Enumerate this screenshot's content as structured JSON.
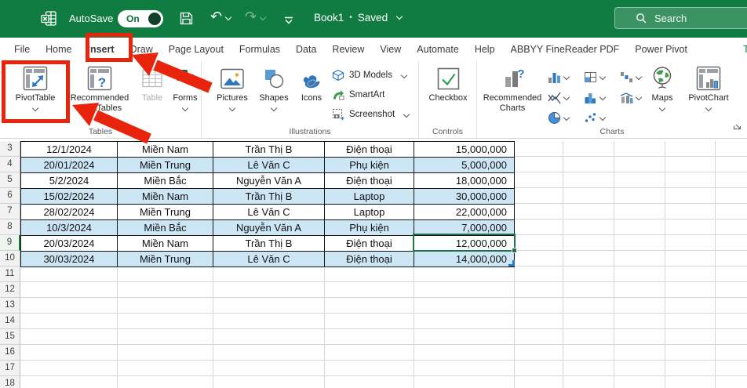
{
  "colors": {
    "excel_green": "#107C41",
    "annotation_red": "#E8240C",
    "band_blue": "#CDE6F5",
    "selection_green": "#1E7446",
    "ribbon_icon_blue": "#2E77C0"
  },
  "titlebar": {
    "autosave_label": "AutoSave",
    "autosave_state": "On",
    "doc_title": "Book1",
    "doc_separator": "•",
    "doc_status": "Saved",
    "search_placeholder": "Search"
  },
  "ribbon_tabs": [
    {
      "label": "File"
    },
    {
      "label": "Home"
    },
    {
      "label": "Insert",
      "active": true
    },
    {
      "label": "Draw"
    },
    {
      "label": "Page Layout"
    },
    {
      "label": "Formulas"
    },
    {
      "label": "Data"
    },
    {
      "label": "Review"
    },
    {
      "label": "View"
    },
    {
      "label": "Automate"
    },
    {
      "label": "Help"
    },
    {
      "label": "ABBYY FineReader PDF"
    },
    {
      "label": "Power Pivot"
    },
    {
      "label": "Tabl",
      "contextual": true
    }
  ],
  "ribbon": {
    "tables": {
      "label": "Tables",
      "pivottable": "PivotTable",
      "recommended_pivottables": "Recommended PivotTables",
      "table": "Table",
      "forms": "Forms"
    },
    "illustrations": {
      "label": "Illustrations",
      "pictures": "Pictures",
      "shapes": "Shapes",
      "icons": "Icons",
      "models_3d": "3D Models",
      "smartart": "SmartArt",
      "screenshot": "Screenshot"
    },
    "controls": {
      "label": "Controls",
      "checkbox": "Checkbox"
    },
    "charts": {
      "label": "Charts",
      "recommended_charts": "Recommended Charts",
      "maps": "Maps",
      "pivotchart": "PivotChart"
    }
  },
  "sheet": {
    "first_row_number": 3,
    "last_row_number": 18,
    "selected_row_number": 9,
    "selected_value": "12,000,000",
    "data_rows": [
      {
        "n": "3",
        "cells": [
          "12/1/2024",
          "Miền Nam",
          "Trần Thị B",
          "Điện thoại",
          "15,000,000"
        ]
      },
      {
        "n": "4",
        "cells": [
          "20/01/2024",
          "Miền Trung",
          "Lê Văn C",
          "Phụ kiện",
          "5,000,000"
        ]
      },
      {
        "n": "5",
        "cells": [
          "5/2/2024",
          "Miền Bắc",
          "Nguyễn Văn A",
          "Điện thoại",
          "18,000,000"
        ]
      },
      {
        "n": "6",
        "cells": [
          "15/02/2024",
          "Miền Nam",
          "Trần Thị B",
          "Laptop",
          "30,000,000"
        ]
      },
      {
        "n": "7",
        "cells": [
          "28/02/2024",
          "Miền Trung",
          "Lê Văn C",
          "Laptop",
          "22,000,000"
        ]
      },
      {
        "n": "8",
        "cells": [
          "10/3/2024",
          "Miền Bắc",
          "Nguyễn Văn A",
          "Phụ kiện",
          "7,000,000"
        ]
      },
      {
        "n": "9",
        "cells": [
          "20/03/2024",
          "Miền Nam",
          "Trần Thị B",
          "Điện thoại",
          "12,000,000"
        ]
      },
      {
        "n": "10",
        "cells": [
          "30/03/2024",
          "Miền Trung",
          "Lê Văn C",
          "Điện thoại",
          "14,000,000"
        ]
      }
    ]
  }
}
